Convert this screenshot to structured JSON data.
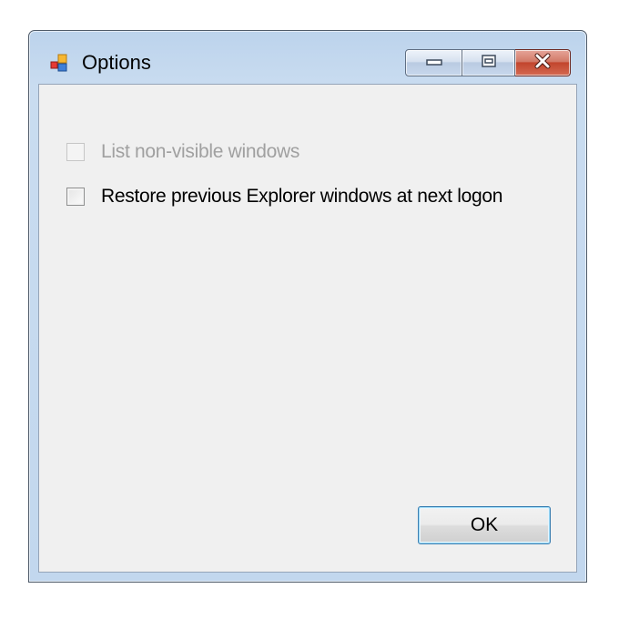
{
  "window": {
    "title": "Options",
    "controls": {
      "minimize_icon": "minimize-icon",
      "maximize_icon": "maximize-icon",
      "close_icon": "close-icon"
    }
  },
  "options": [
    {
      "label": "List non-visible windows",
      "checked": false,
      "enabled": false
    },
    {
      "label": "Restore previous Explorer windows at next logon",
      "checked": false,
      "enabled": true
    }
  ],
  "buttons": {
    "ok_label": "OK"
  },
  "colors": {
    "client_bg": "#f0f0f0",
    "title_frame": "#c2d7ee",
    "close_red": "#c2452d",
    "ok_focus_border": "#3c7fb1",
    "disabled_text": "#a0a0a0"
  }
}
